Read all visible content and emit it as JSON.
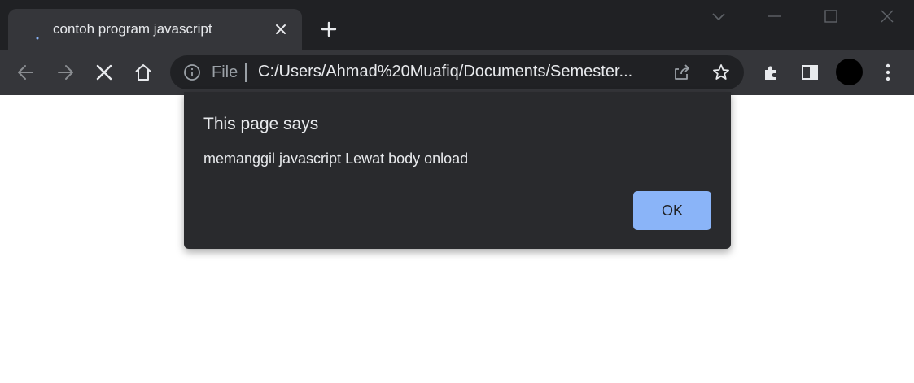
{
  "tab": {
    "title": "contoh program javascript"
  },
  "omnibox": {
    "scheme_label": "File",
    "url": "C:/Users/Ahmad%20Muafiq/Documents/Semester..."
  },
  "dialog": {
    "title": "This page says",
    "message": "memanggil javascript Lewat body onload",
    "ok_label": "OK"
  },
  "colors": {
    "tabstrip_bg": "#202124",
    "toolbar_bg": "#35363a",
    "dialog_bg": "#292a2d",
    "ok_button": "#8ab4f8"
  },
  "icons": [
    "loading-spinner-icon",
    "close-icon",
    "plus-icon",
    "chevron-down-icon",
    "minimize-icon",
    "maximize-icon",
    "window-close-icon",
    "back-arrow-icon",
    "forward-arrow-icon",
    "stop-icon",
    "home-icon",
    "info-icon",
    "share-icon",
    "star-icon",
    "extensions-icon",
    "side-panel-icon",
    "kebab-menu-icon"
  ]
}
